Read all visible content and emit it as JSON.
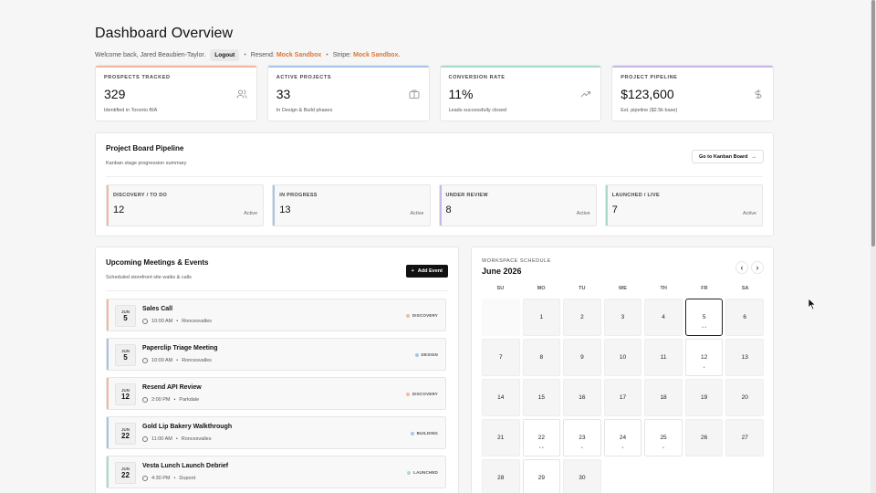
{
  "header": {
    "title": "Dashboard Overview",
    "welcome": "Welcome back, Jared Beaubien-Taylor.",
    "logout": "Logout",
    "resend_label": "Resend:",
    "resend_value": "Mock Sandbox",
    "stripe_label": "Stripe:",
    "stripe_value": "Mock Sandbox."
  },
  "stats": [
    {
      "label": "PROSPECTS TRACKED",
      "value": "329",
      "sub": "Identified in Toronto BIA",
      "icon": "users-icon",
      "color": "#f2b9a0"
    },
    {
      "label": "ACTIVE PROJECTS",
      "value": "33",
      "sub": "In Design & Build phases",
      "icon": "briefcase-icon",
      "color": "#a8c4e8"
    },
    {
      "label": "CONVERSION RATE",
      "value": "11%",
      "sub": "Leads successfully closed",
      "icon": "trending-up-icon",
      "color": "#a8dcc8"
    },
    {
      "label": "PROJECT PIPELINE",
      "value": "$123,600",
      "sub": "Est. pipeline ($2.5k base)",
      "icon": "dollar-icon",
      "color": "#c8b8e6"
    }
  ],
  "pipeline": {
    "title": "Project Board Pipeline",
    "subtitle": "Kanban stage progression summary",
    "button": "Go to Kanban Board",
    "stages": [
      {
        "label": "DISCOVERY / TO DO",
        "value": "12",
        "status": "Active",
        "color": "#f2b9a0"
      },
      {
        "label": "IN PROGRESS",
        "value": "13",
        "status": "Active",
        "color": "#a8c4e8"
      },
      {
        "label": "UNDER REVIEW",
        "value": "8",
        "status": "Active",
        "color": "#c8b8e6"
      },
      {
        "label": "LAUNCHED / LIVE",
        "value": "7",
        "status": "Active",
        "color": "#a8dcc8"
      }
    ]
  },
  "meetings": {
    "title": "Upcoming Meetings & Events",
    "subtitle": "Scheduled storefront site walks & calls",
    "add_button": "Add Event",
    "items": [
      {
        "month": "JUN",
        "day": "5",
        "name": "Sales Call",
        "time": "10:00 AM",
        "place": "Roncesvalles",
        "tag": "DISCOVERY",
        "color": "#f2b9a0"
      },
      {
        "month": "JUN",
        "day": "5",
        "name": "Paperclip Triage Meeting",
        "time": "10:00 AM",
        "place": "Roncesvalles",
        "tag": "DESIGN",
        "color": "#a8c4e8"
      },
      {
        "month": "JUN",
        "day": "12",
        "name": "Resend API Review",
        "time": "2:00 PM",
        "place": "Parkdale",
        "tag": "DISCOVERY",
        "color": "#f2b9a0"
      },
      {
        "month": "JUN",
        "day": "22",
        "name": "Gold Lip Bakery Walkthrough",
        "time": "11:00 AM",
        "place": "Roncesvalles",
        "tag": "BUILDING",
        "color": "#a8c4e8"
      },
      {
        "month": "JUN",
        "day": "22",
        "name": "Vesta Lunch Launch Debrief",
        "time": "4:30 PM",
        "place": "Dupont",
        "tag": "LAUNCHED",
        "color": "#a8dcc8"
      }
    ]
  },
  "calendar": {
    "label": "WORKSPACE SCHEDULE",
    "month": "June 2026",
    "prev": "‹",
    "next": "›",
    "dows": [
      "SU",
      "MO",
      "TU",
      "WE",
      "TH",
      "FR",
      "SA"
    ],
    "days": [
      {
        "d": ""
      },
      {
        "d": "1"
      },
      {
        "d": "2"
      },
      {
        "d": "3"
      },
      {
        "d": "4"
      },
      {
        "d": "5",
        "today": true,
        "dots": "• •"
      },
      {
        "d": "6"
      },
      {
        "d": "7"
      },
      {
        "d": "8"
      },
      {
        "d": "9"
      },
      {
        "d": "10"
      },
      {
        "d": "11"
      },
      {
        "d": "12",
        "white": true,
        "dots": "•"
      },
      {
        "d": "13"
      },
      {
        "d": "14"
      },
      {
        "d": "15"
      },
      {
        "d": "16"
      },
      {
        "d": "17"
      },
      {
        "d": "18"
      },
      {
        "d": "19"
      },
      {
        "d": "20"
      },
      {
        "d": "21"
      },
      {
        "d": "22",
        "white": true,
        "dots": "• •"
      },
      {
        "d": "23",
        "white": true,
        "dots": "•"
      },
      {
        "d": "24",
        "white": true,
        "dots": "•"
      },
      {
        "d": "25",
        "white": true,
        "dots": "•"
      },
      {
        "d": "26"
      },
      {
        "d": "27"
      },
      {
        "d": "28"
      },
      {
        "d": "29",
        "white": true
      },
      {
        "d": "30"
      }
    ]
  }
}
